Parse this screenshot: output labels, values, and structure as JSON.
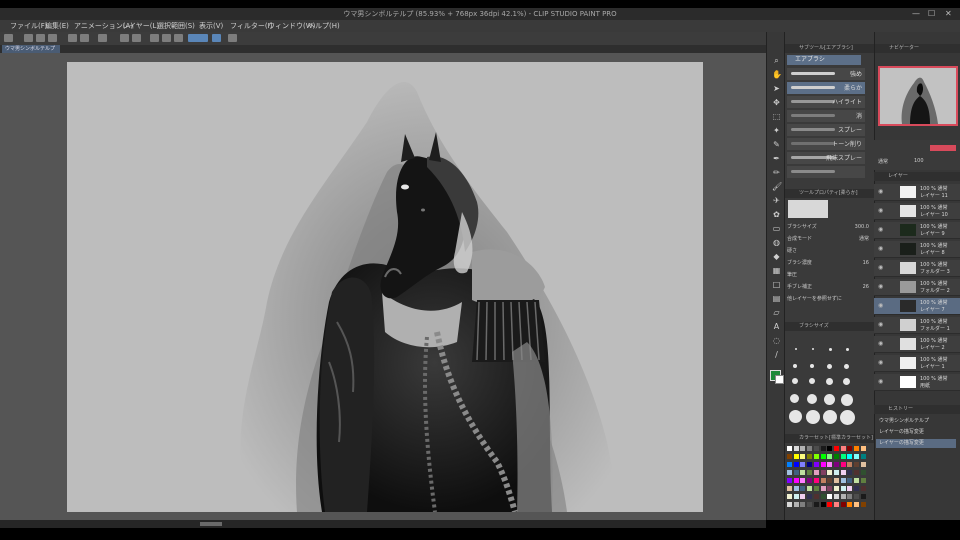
{
  "window": {
    "title": "ウマ男シンボルテルプ (85.93% + 768px 36dpi 42.1%) - CLIP STUDIO PAINT PRO",
    "minimize": "—",
    "maximize": "☐",
    "close": "✕"
  },
  "menu": [
    "ファイル(F)",
    "編集(E)",
    "アニメーション(A)",
    "レイヤー(L)",
    "選択範囲(S)",
    "表示(V)",
    "フィルター(I)",
    "ウィンドウ(W)",
    "ヘルプ(H)"
  ],
  "document_tab": "ウマ男シンボルテルプ",
  "subtool": {
    "header": "サブツール[エアブラシ]",
    "group": "エアブラシ",
    "brushes": [
      {
        "label": "強め",
        "selected": false
      },
      {
        "label": "柔らか",
        "selected": true
      },
      {
        "label": "ハイライト",
        "selected": false
      },
      {
        "label": "消",
        "selected": false
      },
      {
        "label": "スプレー",
        "selected": false
      },
      {
        "label": "トーン削り",
        "selected": false
      },
      {
        "label": "飛沫スプレー",
        "selected": false
      },
      {
        "label": "",
        "selected": false
      }
    ]
  },
  "tool_property": {
    "header": "ツールプロパティ[柔らか]",
    "brush_size_label": "ブラシサイズ",
    "brush_size_value": "300.0",
    "blend_label": "合成モード",
    "blend_value": "通常",
    "density_label": "ブラシ濃度",
    "density_value": "16",
    "aa_label": "硬さ",
    "stabilize_label": "手ブレ補正",
    "stabilize_value": "26",
    "ref_label": "他レイヤーを参照せずに",
    "pressure_label": "筆圧"
  },
  "brush_size_panel": {
    "header": "ブラシサイズ",
    "sizes": [
      "0.7",
      "1",
      "1.5",
      "2",
      "2.5",
      "3",
      "4",
      "5",
      "6",
      "7",
      "8",
      "10",
      "12",
      "15",
      "17",
      "20",
      "25",
      "30",
      "40",
      "50",
      "60",
      "70"
    ]
  },
  "color_set": {
    "header": "カラーセット[標準カラーセット]",
    "swatches": [
      "#ffffff",
      "#d9d9d9",
      "#b3b3b3",
      "#808080",
      "#4d4d4d",
      "#1a1a1a",
      "#000000",
      "#ff0000",
      "#ff8080",
      "#800000",
      "#ff8000",
      "#ffc080",
      "#804000",
      "#ffff00",
      "#ffff80",
      "#808000",
      "#80ff00",
      "#00ff00",
      "#80ff80",
      "#008000",
      "#00ff80",
      "#00ffff",
      "#80ffff",
      "#008080",
      "#0080ff",
      "#0000ff",
      "#8080ff",
      "#000080",
      "#8000ff",
      "#ff00ff",
      "#ff80ff",
      "#800080",
      "#ff0080",
      "#c08060",
      "#604030",
      "#e0c0a0",
      "#a0c0e0",
      "#406080",
      "#c0e0a0",
      "#608040",
      "#e0a0c0",
      "#804060",
      "#f0f0d0",
      "#d0f0f0",
      "#f0d0f0",
      "#303050",
      "#503030",
      "#305030"
    ]
  },
  "navigator": {
    "header": "ナビゲーター"
  },
  "layers": {
    "header": "レイヤー",
    "blend": "通常",
    "opacity": "100",
    "items": [
      {
        "pct": "100 % 通常",
        "name": "レイヤー 11",
        "thumb": "#f2f2f2",
        "selected": false
      },
      {
        "pct": "100 % 通常",
        "name": "レイヤー 10",
        "thumb": "#e4e4e4",
        "selected": false
      },
      {
        "pct": "100 % 通常",
        "name": "レイヤー 9",
        "thumb": "#1c2a1c",
        "selected": false
      },
      {
        "pct": "100 % 通常",
        "name": "レイヤー 8",
        "thumb": "#1a1f1a",
        "selected": false
      },
      {
        "pct": "100 % 通常",
        "name": "フォルダー 3",
        "thumb": "#d8d8d8",
        "selected": false
      },
      {
        "pct": "100 % 通常",
        "name": "フォルダー 2",
        "thumb": "#9a9a9a",
        "selected": false
      },
      {
        "pct": "100 % 通常",
        "name": "レイヤー 7",
        "thumb": "#2a2a2a",
        "selected": true
      },
      {
        "pct": "100 % 通常",
        "name": "フォルダー 1",
        "thumb": "#d0d0d0",
        "selected": false
      },
      {
        "pct": "100 % 通常",
        "name": "レイヤー 2",
        "thumb": "#e0e0e0",
        "selected": false
      },
      {
        "pct": "100 % 通常",
        "name": "レイヤー 1",
        "thumb": "#f0f0f0",
        "selected": false
      },
      {
        "pct": "100 % 通常",
        "name": "用紙",
        "thumb": "#ffffff",
        "selected": false
      }
    ]
  },
  "history": {
    "header": "ヒストリー",
    "items": [
      {
        "label": "ウマ男シンボルテルプ",
        "selected": false
      },
      {
        "label": "レイヤーの描写変更",
        "selected": false
      },
      {
        "label": "レイヤーの描写変更",
        "selected": true
      }
    ]
  },
  "colors": {
    "accent": "#5a6b82",
    "nav_border": "#d84a5b",
    "main_color": "#1f8a3a"
  }
}
